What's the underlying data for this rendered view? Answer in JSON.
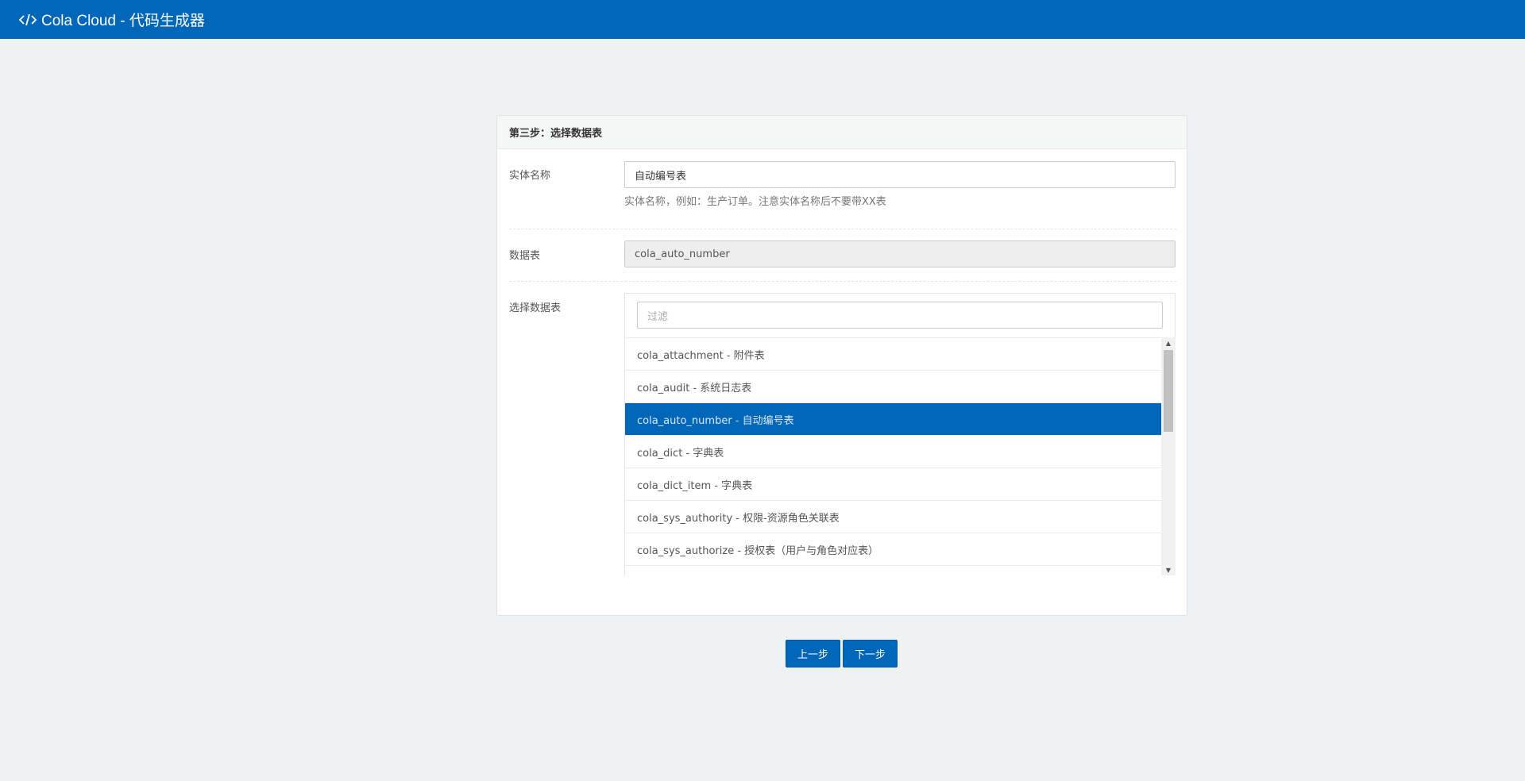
{
  "header": {
    "title": "Cola Cloud - 代码生成器",
    "icon": "code-icon",
    "background": "#0066b8"
  },
  "panel": {
    "title": "第三步：选择数据表"
  },
  "form": {
    "entity_name": {
      "label": "实体名称",
      "value": "自动编号表",
      "help": "实体名称，例如：生产订单。注意实体名称后不要带XX表"
    },
    "table": {
      "label": "数据表",
      "value": "cola_auto_number"
    },
    "select_table": {
      "label": "选择数据表",
      "filter_placeholder": "过滤",
      "items": [
        {
          "label": "cola_attachment - 附件表",
          "selected": false
        },
        {
          "label": "cola_audit - 系统日志表",
          "selected": false
        },
        {
          "label": "cola_auto_number - 自动编号表",
          "selected": true
        },
        {
          "label": "cola_dict - 字典表",
          "selected": false
        },
        {
          "label": "cola_dict_item - 字典表",
          "selected": false
        },
        {
          "label": "cola_sys_authority - 权限-资源角色关联表",
          "selected": false
        },
        {
          "label": "cola_sys_authorize - 授权表（用户与角色对应表）",
          "selected": false
        },
        {
          "label": "",
          "selected": false
        }
      ]
    }
  },
  "buttons": {
    "prev": "上一步",
    "next": "下一步"
  },
  "colors": {
    "accent": "#0066b8",
    "page_background": "#eef2f3"
  }
}
